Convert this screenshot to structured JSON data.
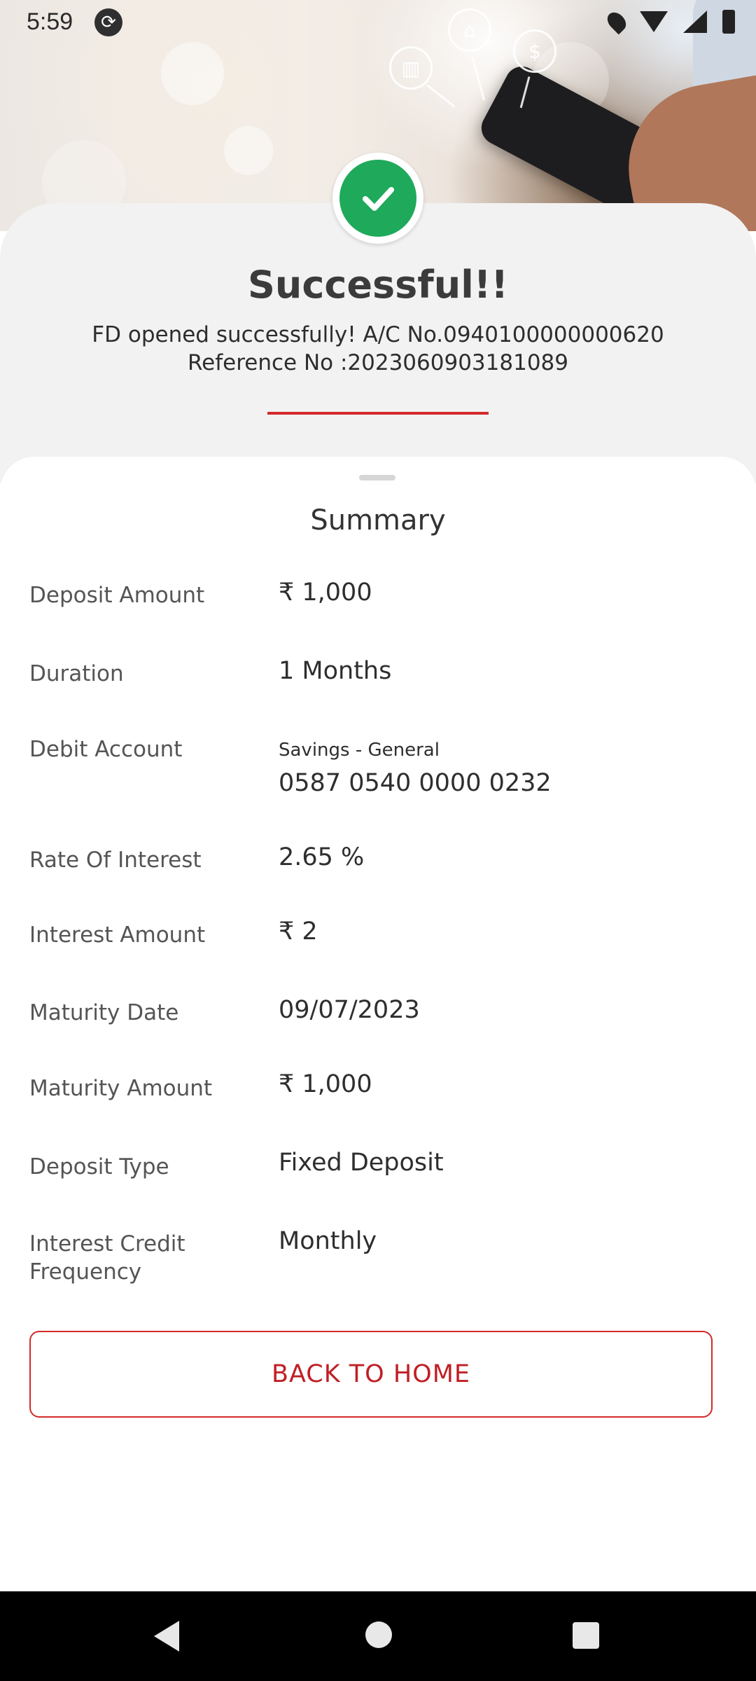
{
  "status_bar": {
    "time": "5:59"
  },
  "result": {
    "title": "Successful!!",
    "message_line1": "FD opened successfully! A/C No.0940100000000620",
    "message_line2": "Reference No :2023060903181089"
  },
  "summary": {
    "heading": "Summary",
    "rows": [
      {
        "label": "Deposit Amount",
        "value": "₹ 1,000"
      },
      {
        "label": "Duration",
        "value": "1 Months"
      },
      {
        "label": "Debit Account",
        "sub": "Savings - General",
        "value": "0587 0540 0000 0232"
      },
      {
        "label": "Rate Of Interest",
        "value": "2.65 %"
      },
      {
        "label": "Interest Amount",
        "value": "₹ 2"
      },
      {
        "label": "Maturity Date",
        "value": "09/07/2023"
      },
      {
        "label": "Maturity Amount",
        "value": "₹ 1,000"
      },
      {
        "label": "Deposit Type",
        "value": "Fixed Deposit"
      },
      {
        "label": "Interest Credit Frequency",
        "value": "Monthly"
      }
    ]
  },
  "actions": {
    "back_home": "BACK TO HOME"
  },
  "colors": {
    "success": "#1fa95b",
    "accent_red": "#d42a2a",
    "button_text": "#c01f25"
  },
  "icons": [
    "sync-icon",
    "location-icon",
    "wifi-icon",
    "signal-icon",
    "battery-icon",
    "checkmark-icon",
    "nav-back-icon",
    "nav-home-icon",
    "nav-recents-icon"
  ]
}
